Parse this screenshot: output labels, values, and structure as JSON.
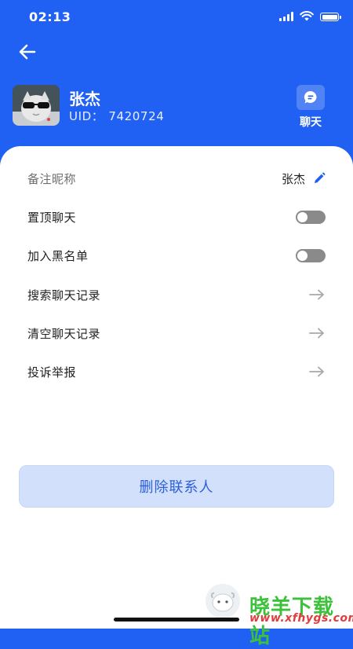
{
  "status": {
    "time": "02:13"
  },
  "contact": {
    "name": "张杰",
    "uid_label": "UID：",
    "uid_value": "7420724"
  },
  "header_actions": {
    "chat_label": "聊天"
  },
  "settings": {
    "remark_label": "备注昵称",
    "remark_value": "张杰",
    "pin_label": "置顶聊天",
    "pin_enabled": false,
    "blacklist_label": "加入黑名单",
    "blacklist_enabled": false,
    "search_history_label": "搜索聊天记录",
    "clear_history_label": "清空聊天记录",
    "report_label": "投诉举报"
  },
  "delete_label": "删除联系人",
  "watermark": {
    "text": "晓羊下载站",
    "url": "www.xfhygs.com"
  },
  "colors": {
    "primary": "#2061f3",
    "toggle_off": "#8a8a8a",
    "delete_bg": "#d2e0fb",
    "delete_text": "#2b5fdc"
  },
  "icons": [
    "back-arrow-icon",
    "chat-bubble-icon",
    "edit-pencil-icon",
    "arrow-right-icon"
  ]
}
